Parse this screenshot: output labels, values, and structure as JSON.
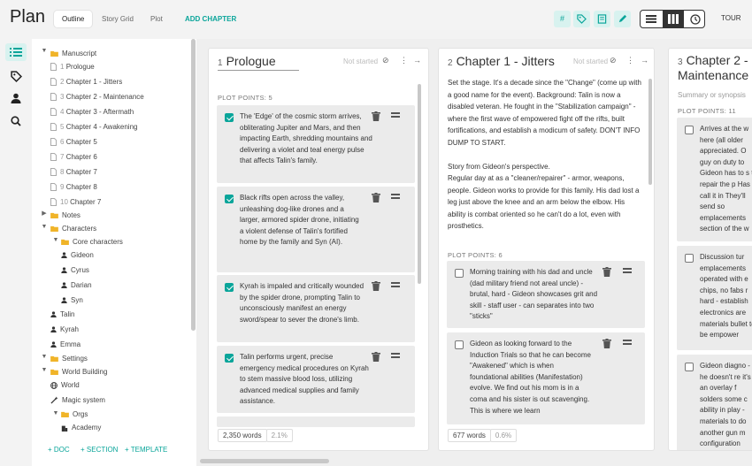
{
  "app": {
    "title": "Plan"
  },
  "tabs": [
    {
      "label": "Outline"
    },
    {
      "label": "Story Grid"
    },
    {
      "label": "Plot"
    }
  ],
  "add_chapter": "ADD CHAPTER",
  "tour": "TOUR",
  "tree": {
    "manuscript": "Manuscript",
    "chapters": [
      {
        "num": "1",
        "title": "Prologue"
      },
      {
        "num": "2",
        "title": "Chapter 1 - Jitters"
      },
      {
        "num": "3",
        "title": "Chapter 2 - Maintenance"
      },
      {
        "num": "4",
        "title": "Chapter 3 - Aftermath"
      },
      {
        "num": "5",
        "title": "Chapter 4 - Awakening"
      },
      {
        "num": "6",
        "title": "Chapter 5"
      },
      {
        "num": "7",
        "title": "Chapter 6"
      },
      {
        "num": "8",
        "title": "Chapter 7"
      },
      {
        "num": "9",
        "title": "Chapter 8"
      },
      {
        "num": "10",
        "title": "Chapter 7"
      }
    ],
    "notes": "Notes",
    "characters": "Characters",
    "core_characters": "Core characters",
    "core": [
      "Gideon",
      "Cyrus",
      "Darian",
      "Syn"
    ],
    "other_chars": [
      "Talin",
      "Kyrah",
      "Emma"
    ],
    "settings": "Settings",
    "world_building": "World Building",
    "world": "World",
    "magic": "Magic system",
    "orgs": "Orgs",
    "academy": "Academy"
  },
  "footer": {
    "doc": "+ DOC",
    "section": "+ SECTION",
    "template": "+ TEMPLATE"
  },
  "columns": [
    {
      "num": "1",
      "title": "Prologue",
      "status": "Not started",
      "plot_label": "PLOT POINTS: 5",
      "cards": [
        {
          "checked": true,
          "text": "The 'Edge' of the cosmic storm arrives, obliterating Jupiter and Mars, and then impacting Earth, shredding mountains and delivering a violet and teal energy pulse that affects Talin's family."
        },
        {
          "checked": true,
          "text": "Black rifts open across the valley, unleashing dog-like drones and a larger, armored spider drone, initiating a violent defense of Talin's fortified home by the family and Syn (AI)."
        },
        {
          "checked": true,
          "text": "Kyrah is impaled and critically wounded by the spider drone, prompting Talin to unconsciously manifest an energy sword/spear to sever the drone's limb."
        },
        {
          "checked": true,
          "text": "Talin performs urgent, precise emergency medical procedures on Kyrah to stem massive blood loss, utilizing advanced medical supplies and family assistance."
        }
      ],
      "words": "2,350 words",
      "pct": "2.1%"
    },
    {
      "num": "2",
      "title": "Chapter 1 - Jitters",
      "status": "Not started",
      "synopsis": "Set the stage. It's a decade since the \"Change\" (come up with a good name for the event). Background: Talin is now a disabled veteran. He fought in the \"Stabilization campaign\" - where the first wave of empowered fight off the rifts, built fortifications, and establish a modicum of safety. DON'T INFO DUMP TO START.\n\nStory from Gideon's perspective.\nRegular day at as a \"cleaner/repairer\" - armor, weapons, people. Gideon works to provide for this family. His dad lost a leg just above the knee and an arm below the elbow. His ability is combat oriented so he can't do a lot, even with prosthetics.",
      "plot_label": "PLOT POINTS: 6",
      "cards": [
        {
          "checked": false,
          "text": "Morning training with his dad and uncle (dad military friend not  areal uncle) - brutal, hard - Gideon showcases grit and skill - staff user - can separates into two \"sticks\""
        },
        {
          "checked": false,
          "text": "Gideon as looking forward to the Induction Trials so that he can become \"Awakened\" which is when foundational abilities (Manifestation) evolve. We find out his mom is in a coma and his sister is out scavenging. This is where we learn"
        }
      ],
      "words": "677 words",
      "pct": "0.6%"
    },
    {
      "num": "3",
      "title": "Chapter 2 - Maintenance",
      "synopsis": "Summary or synopsis",
      "plot_label": "PLOT POINTS: 11",
      "cards": [
        {
          "checked": false,
          "text": "Arrives at the w here (all older appreciated. O guy on duty to Gideon has to s to repair the p Has to call it in They'll send so emplacements section of the w"
        },
        {
          "checked": false,
          "text": "Discussion tur emplacements operated with e chips, no fabs r hard - establish electronics are materials bullet to be empower"
        },
        {
          "checked": false,
          "text": "Gideon diagno - he doesn't re it's an overlay f solders some c ability in play - materials to do another gun m configuration"
        }
      ]
    }
  ]
}
